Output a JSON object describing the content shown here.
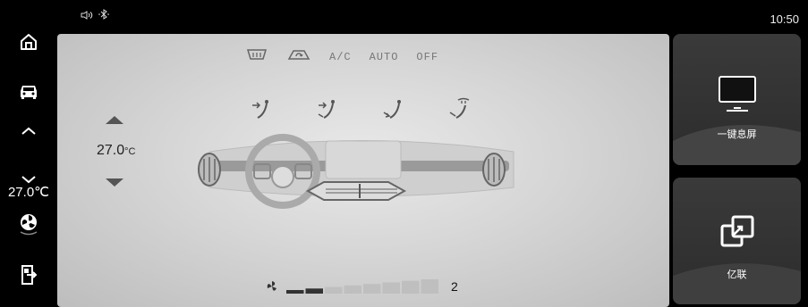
{
  "status": {
    "time": "10:50",
    "icons": [
      "volume-icon",
      "bluetooth-icon"
    ]
  },
  "sidebar": {
    "items": [
      "home-icon",
      "car-icon",
      "temp-up-icon",
      "temp-down-icon",
      "fan-icon",
      "exit-icon"
    ],
    "temperature": "27.0℃"
  },
  "climate": {
    "buttons": [
      {
        "name": "rear-defrost-icon"
      },
      {
        "name": "recirculation-icon"
      },
      {
        "label": "A/C"
      },
      {
        "label": "AUTO"
      },
      {
        "label": "OFF"
      }
    ],
    "vent_modes": [
      "face-vent-icon",
      "face-feet-vent-icon",
      "feet-vent-icon",
      "windshield-feet-vent-icon"
    ],
    "temperature_value": "27.0",
    "temperature_unit": "°C",
    "fan_level": "2",
    "fan_level_fraction": 0.25
  },
  "cards": [
    {
      "label": "一键息屏",
      "icon": "monitor-icon"
    },
    {
      "label": "亿联",
      "icon": "link-icon"
    }
  ]
}
